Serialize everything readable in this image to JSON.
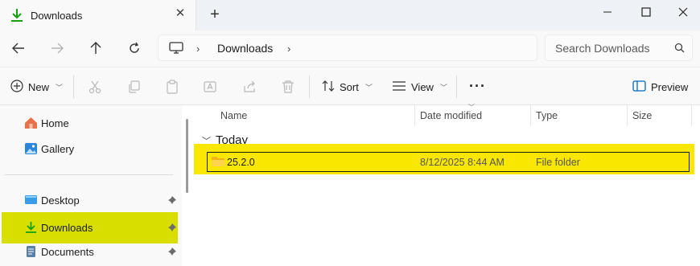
{
  "window": {
    "tab_title": "Downloads",
    "new_tab_symbol": "+",
    "close_tab_symbol": "✕"
  },
  "addressbar": {
    "breadcrumb": [
      "Downloads"
    ],
    "search_placeholder": "Search Downloads"
  },
  "commandbar": {
    "new_label": "New",
    "sort_label": "Sort",
    "view_label": "View",
    "more_label": "···",
    "preview_label": "Preview",
    "disabled_actions": [
      "cut-icon",
      "copy-icon",
      "paste-icon",
      "rename-icon",
      "share-icon",
      "delete-icon"
    ]
  },
  "sidebar": {
    "items": [
      {
        "label": "Home",
        "icon": "home-icon"
      },
      {
        "label": "Gallery",
        "icon": "gallery-icon"
      },
      {
        "label": "Desktop",
        "icon": "desktop-icon",
        "pinned": true
      },
      {
        "label": "Downloads",
        "icon": "download-icon",
        "pinned": true,
        "selected": true
      },
      {
        "label": "Documents",
        "icon": "documents-icon",
        "pinned": true
      }
    ]
  },
  "filelist": {
    "columns": [
      "Name",
      "Date modified",
      "Type",
      "Size"
    ],
    "sorted_by": "Date modified",
    "groups": [
      {
        "label": "Today",
        "rows": [
          {
            "name": "25.2.0",
            "date_modified": "8/12/2025 8:44 AM",
            "type": "File folder",
            "size": ""
          }
        ]
      }
    ]
  },
  "colors": {
    "highlight": "#f9e700",
    "sidebar_highlight": "#d7de00",
    "accent": "#0f9d58"
  }
}
